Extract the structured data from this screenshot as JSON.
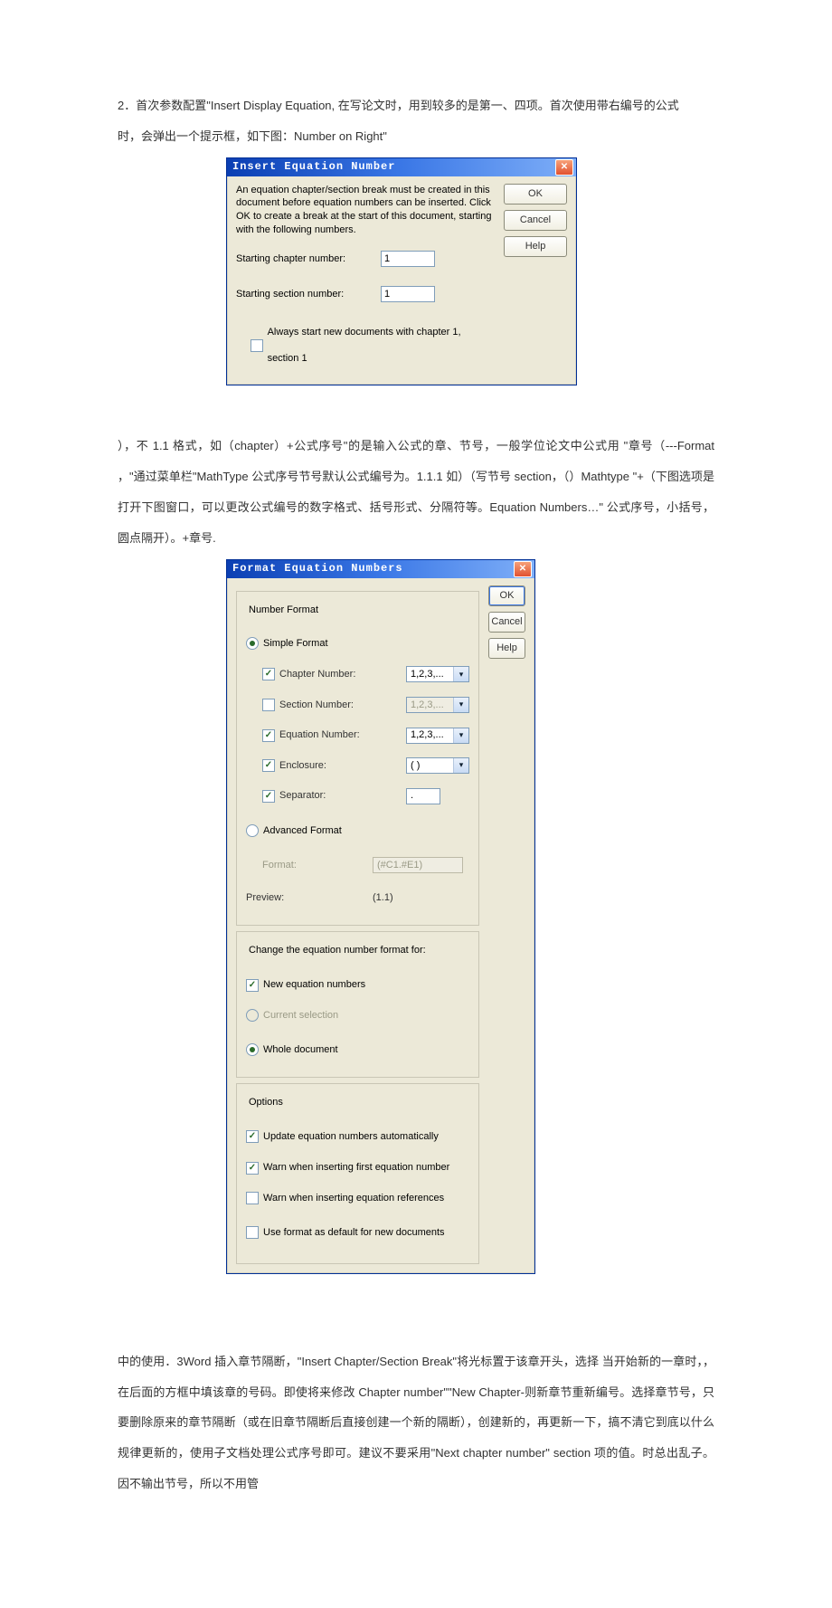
{
  "para1": "2．首次参数配置\"Insert Display Equation,  在写论文时，用到较多的是第一、四项。首次使用带右编号的公式",
  "para1b": " 时，会弹出一个提示框，如下图：Number on Right\"",
  "dlg1": {
    "title": "Insert Equation Number",
    "msg": "An equation chapter/section break must be created in this document before equation numbers can be inserted. Click OK to create a break at the start of this document, starting with the following numbers.",
    "chapLabel": "Starting chapter number:",
    "chapVal": "1",
    "secLabel": "Starting section number:",
    "secVal": "1",
    "always": "Always start new documents with chapter 1, section 1",
    "ok": "OK",
    "cancel": "Cancel",
    "help": "Help"
  },
  "para2": "），不 1.1 格式，如（chapter）+公式序号\"的是输入公式的章、节号，一般学位论文中公式用         \"章号（---Format ，\"通过菜单栏\"MathType 公式序号节号默认公式编号为。1.1.1 如）（写节号 section，（）Mathtype \"+（下图选项是打开下图窗口，可以更改公式编号的数字格式、括号形式、分隔符等。Equation Numbers…\"  公式序号，小括号，圆点隔开）。+章号.",
  "dlg2": {
    "title": "Format Equation Numbers",
    "nf": "Number Format",
    "simple": "Simple Format",
    "chapNum": "Chapter Number:",
    "secNum": "Section Number:",
    "eqNum": "Equation Number:",
    "enclosure": "Enclosure:",
    "sep": "Separator:",
    "c123": "1,2,3,...",
    "cParen": "( )",
    "cDot": ".",
    "adv": "Advanced Format",
    "fmtLabel": "Format:",
    "fmtVal": "(#C1.#E1)",
    "preview": "Preview:",
    "previewVal": "(1.1)",
    "changeFor": "Change the equation number format for:",
    "newEq": "New equation numbers",
    "curSel": "Current selection",
    "whole": "Whole document",
    "options": "Options",
    "optA": "Update equation numbers automatically",
    "optB": "Warn when inserting first equation number",
    "optC": "Warn when inserting equation references",
    "optD": "Use format as default for new documents",
    "ok": "OK",
    "cancel": "Cancel",
    "help": "Help"
  },
  "para3": " 中的使用．3Word 插入章节隔断，\"Insert Chapter/Section Break\"将光标置于该章开头，选择          当开始新的一章时，，在后面的方框中填该章的号码。即使将来修改 Chapter number\"\"New Chapter-则新章节重新编号。选择章节号，只要删除原来的章节隔断（或在旧章节隔断后直接创建一个新的隔断），创建新的，再更新一下，搞不清它到底以什么规律更新的，使用子文档处理公式序号即可。建议不要采用\"Next chapter number\"  section 项的值。时总出乱子。因不输出节号，所以不用管"
}
